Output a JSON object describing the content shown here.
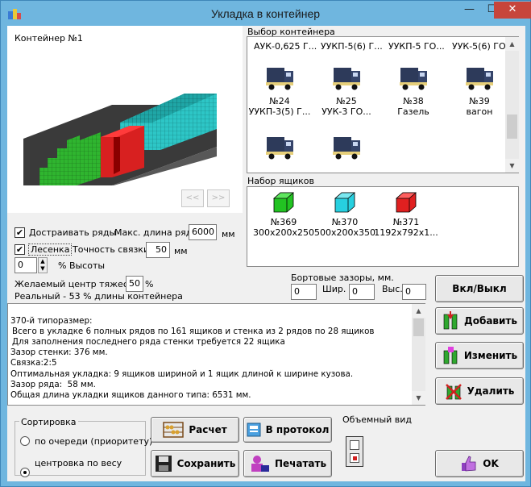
{
  "window": {
    "title": "Укладка в контейнер",
    "minimize": "—",
    "maximize": "☐",
    "close": "✕"
  },
  "preview": {
    "container_label": "Контейнер №1",
    "prev": "<<",
    "next": ">>"
  },
  "options": {
    "fill_rows_label": "Достраивать ряды",
    "fill_rows_checked": "✔",
    "max_row_len_label": "Макс. длина ряда",
    "max_row_len_value": "6000",
    "max_row_len_unit": "мм",
    "ladder_label": "Лесенка",
    "ladder_checked": "✔",
    "precision_label": "Точность связки",
    "precision_value": "50",
    "precision_unit": "мм",
    "height_value": "0",
    "height_label": "% Высоты",
    "center_label": "Желаемый центр тяжести",
    "center_value": "50",
    "center_unit": "%",
    "real_label": "Реальный -  53 % длины контейнера"
  },
  "container_select": {
    "header": "Выбор контейнера",
    "top_row": [
      "АУК-0,625 Г...",
      "УУКП-5(6) Г...",
      "УУКП-5 ГО...",
      "УУК-5(6) ГО..."
    ],
    "items": [
      {
        "line1": "№24",
        "line2": "УУКП-3(5) Г..."
      },
      {
        "line1": "№25",
        "line2": "УУК-3 ГО..."
      },
      {
        "line1": "№38",
        "line2": "Газель"
      },
      {
        "line1": "№39",
        "line2": "вагон"
      }
    ]
  },
  "boxes": {
    "header": "Набор ящиков",
    "items": [
      {
        "line1": "№369",
        "line2": "300x200x250",
        "color": "#22c322"
      },
      {
        "line1": "№370",
        "line2": "500x200x350",
        "color": "#27d0e0"
      },
      {
        "line1": "№371",
        "line2": "1192x792x1...",
        "color": "#e02020"
      }
    ]
  },
  "gaps": {
    "title": "Бортовые  зазоры, мм.",
    "board_value": "0",
    "width_label": "Шир.",
    "width_value": "0",
    "height_label": "Выс.",
    "height_value": "0"
  },
  "log": {
    "lines": [
      "370-й типоразмер:",
      "Всего в укладке 6 полных рядов по 161 ящиков и стенка из 2 рядов по 28 ящиков",
      "Для заполнения последнего ряда стенки требуется 22 ящика",
      "Зазор стенки: 376 мм.",
      "Связка:2:5",
      "Оптимальная укладка: 9 ящиков шириной и 1 ящик длиной к ширине кузова.",
      "Зазор ряда:  58 мм.",
      "Общая длина укладки ящиков данного типа: 6531 мм."
    ]
  },
  "side_buttons": {
    "toggle": "Вкл/Выкл",
    "add": "Добавить",
    "edit": "Изменить",
    "delete": "Удалить",
    "ok": "OK"
  },
  "sort": {
    "title": "Сортировка",
    "option1": "по очереди (приоритету)",
    "option2": "центровка по весу"
  },
  "bottom_buttons": {
    "calc": "Расчет",
    "protocol": "В протокол",
    "save": "Сохранить",
    "print": "Печатать",
    "volume_view": "Объемный вид"
  }
}
